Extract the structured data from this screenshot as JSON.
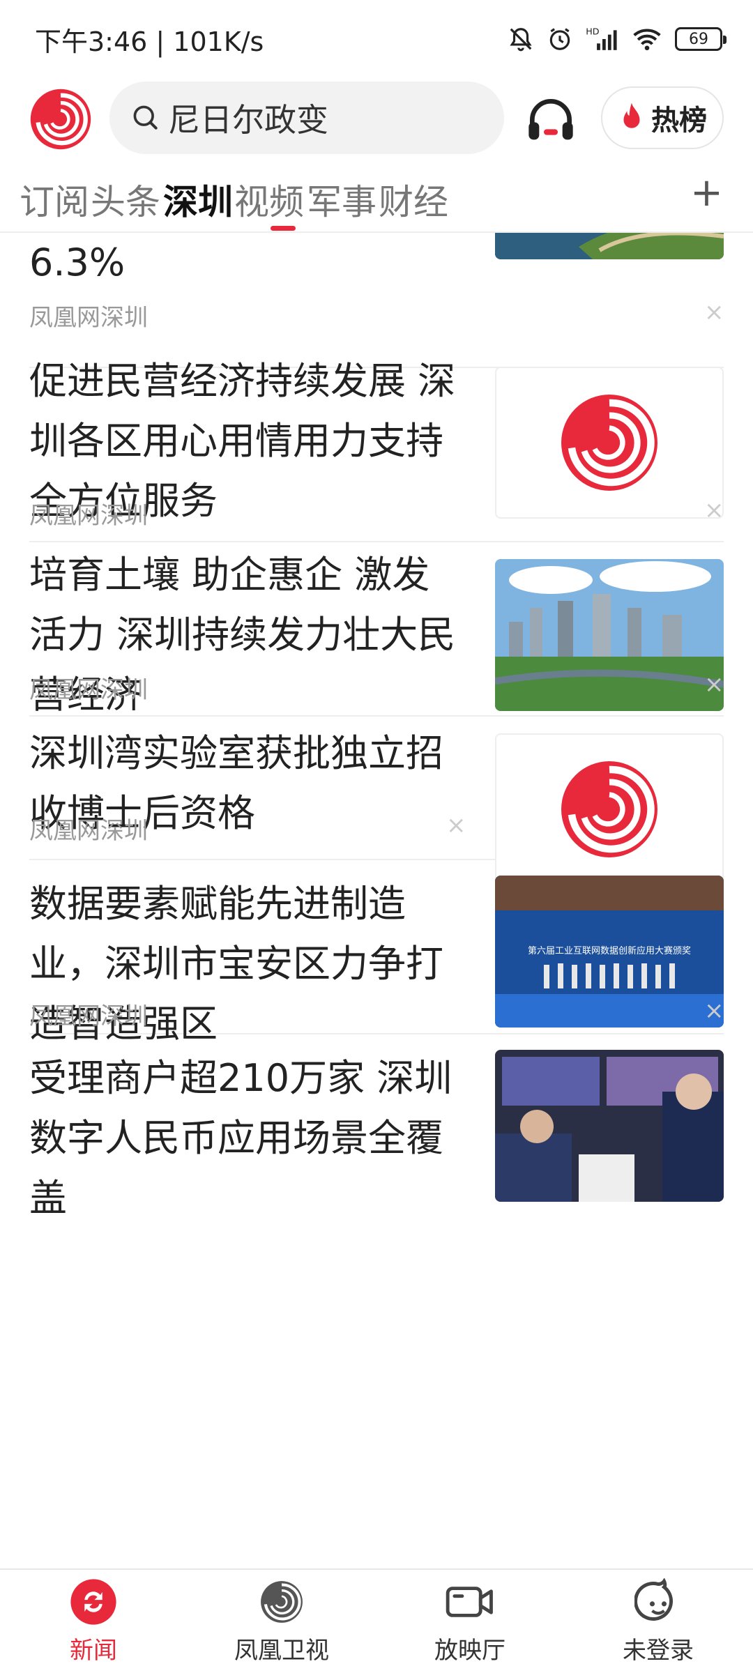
{
  "status_bar": {
    "time_speed": "下午3:46 | 101K/s",
    "battery": "69"
  },
  "header": {
    "search_placeholder": "尼日尔政变",
    "hot_label": "热榜"
  },
  "tabs": [
    {
      "label": "订阅"
    },
    {
      "label": "头条"
    },
    {
      "label": "深圳",
      "active": true
    },
    {
      "label": "视频"
    },
    {
      "label": "军事"
    },
    {
      "label": "财经"
    }
  ],
  "tab_add": "+",
  "feed": [
    {
      "title": "6.3%",
      "source": "凤凰网深圳",
      "image": "waterfront-photo"
    },
    {
      "title": "促进民营经济持续发展 深圳各区用心用情用力支持全方位服务",
      "source": "凤凰网深圳",
      "image": "phoenix-logo"
    },
    {
      "title": "培育土壤 助企惠企 激发活力 深圳持续发力壮大民营经济",
      "source": "凤凰网深圳",
      "image": "city-aerial-photo"
    },
    {
      "title": "深圳湾实验室获批独立招收博士后资格",
      "source": "凤凰网深圳",
      "image": "phoenix-logo"
    },
    {
      "title": "数据要素赋能先进制造业，深圳市宝安区力争打造智造强区",
      "source": "凤凰网深圳",
      "image": "conference-stage-photo",
      "image_caption": "第六届工业互联网数据创新应用大赛颁奖"
    },
    {
      "title": "受理商户超210万家 深圳数字人民币应用场景全覆盖",
      "source": "",
      "image": "digital-rmb-photo"
    }
  ],
  "close_glyph": "×",
  "bottom_nav": [
    {
      "label": "新闻",
      "icon": "refresh-icon",
      "active": true
    },
    {
      "label": "凤凰卫视",
      "icon": "phoenix-tv-icon"
    },
    {
      "label": "放映厅",
      "icon": "video-camera-icon"
    },
    {
      "label": "未登录",
      "icon": "user-face-icon"
    }
  ],
  "colors": {
    "accent": "#e8293b",
    "text": "#222222",
    "muted": "#999999"
  }
}
